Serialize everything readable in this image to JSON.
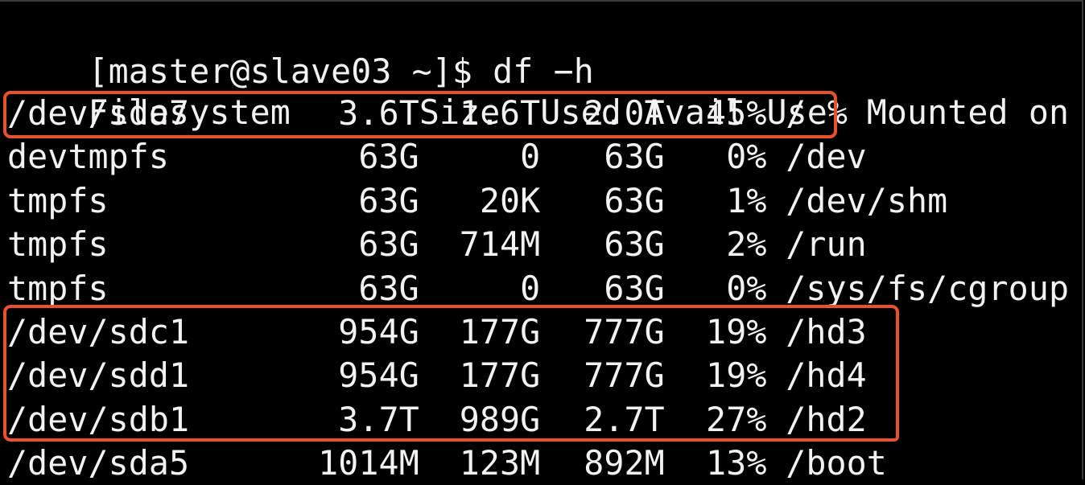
{
  "terminal": {
    "prompt": "[master@slave03 ~]$ df −h",
    "user": "master",
    "host": "slave03",
    "cwd": "~",
    "command": "df −h"
  },
  "table": {
    "headers": {
      "filesystem": "Filesystem",
      "size": "Size",
      "used": "Used",
      "avail": "Avail",
      "use_pct": "Use%",
      "mounted_on": "Mounted on"
    },
    "rows": [
      {
        "filesystem": "/dev/sda7",
        "size": "3.6T",
        "used": "1.6T",
        "avail": "2.0T",
        "use_pct": "45%",
        "mounted_on": "/"
      },
      {
        "filesystem": "devtmpfs",
        "size": "63G",
        "used": "0",
        "avail": "63G",
        "use_pct": "0%",
        "mounted_on": "/dev"
      },
      {
        "filesystem": "tmpfs",
        "size": "63G",
        "used": "20K",
        "avail": "63G",
        "use_pct": "1%",
        "mounted_on": "/dev/shm"
      },
      {
        "filesystem": "tmpfs",
        "size": "63G",
        "used": "714M",
        "avail": "63G",
        "use_pct": "2%",
        "mounted_on": "/run"
      },
      {
        "filesystem": "tmpfs",
        "size": "63G",
        "used": "0",
        "avail": "63G",
        "use_pct": "0%",
        "mounted_on": "/sys/fs/cgroup"
      },
      {
        "filesystem": "/dev/sdc1",
        "size": "954G",
        "used": "177G",
        "avail": "777G",
        "use_pct": "19%",
        "mounted_on": "/hd3"
      },
      {
        "filesystem": "/dev/sdd1",
        "size": "954G",
        "used": "177G",
        "avail": "777G",
        "use_pct": "19%",
        "mounted_on": "/hd4"
      },
      {
        "filesystem": "/dev/sdb1",
        "size": "3.7T",
        "used": "989G",
        "avail": "2.7T",
        "use_pct": "27%",
        "mounted_on": "/hd2"
      },
      {
        "filesystem": "/dev/sda5",
        "size": "1014M",
        "used": "123M",
        "avail": "892M",
        "use_pct": "13%",
        "mounted_on": "/boot"
      }
    ]
  },
  "annotations": {
    "highlight_color": "#e8522a",
    "boxes": [
      {
        "label": "root-partition-highlight",
        "rows": [
          0
        ]
      },
      {
        "label": "data-disks-highlight",
        "rows": [
          5,
          6,
          7
        ]
      }
    ]
  }
}
